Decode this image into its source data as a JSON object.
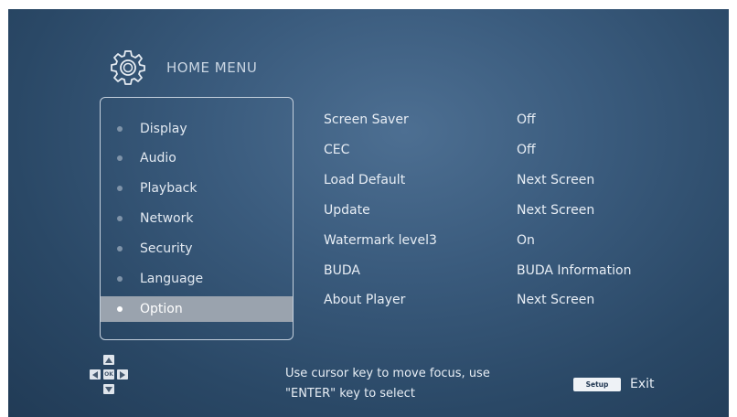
{
  "header": {
    "title": "HOME MENU",
    "icon": "gear-icon"
  },
  "menu": {
    "items": [
      {
        "label": "Display"
      },
      {
        "label": "Audio"
      },
      {
        "label": "Playback"
      },
      {
        "label": "Network"
      },
      {
        "label": "Security"
      },
      {
        "label": "Language"
      },
      {
        "label": "Option"
      }
    ],
    "selected": "Option"
  },
  "settings": [
    {
      "name": "Screen Saver",
      "value": "Off"
    },
    {
      "name": "CEC",
      "value": "Off"
    },
    {
      "name": "Load Default",
      "value": "Next Screen"
    },
    {
      "name": "Update",
      "value": "Next Screen"
    },
    {
      "name": "Watermark level3",
      "value": "On"
    },
    {
      "name": "BUDA",
      "value": "BUDA Information"
    },
    {
      "name": "About Player",
      "value": "Next Screen"
    }
  ],
  "footer": {
    "dpad_ok": "OK",
    "hint_line1": "Use cursor key to move focus, use",
    "hint_line2": "\"ENTER\" key to select",
    "setup_button": "Setup",
    "exit_label": "Exit"
  },
  "colors": {
    "background": "#2e4d6c",
    "selected_row": "#9aa3ae",
    "text": "#e8eef5"
  }
}
